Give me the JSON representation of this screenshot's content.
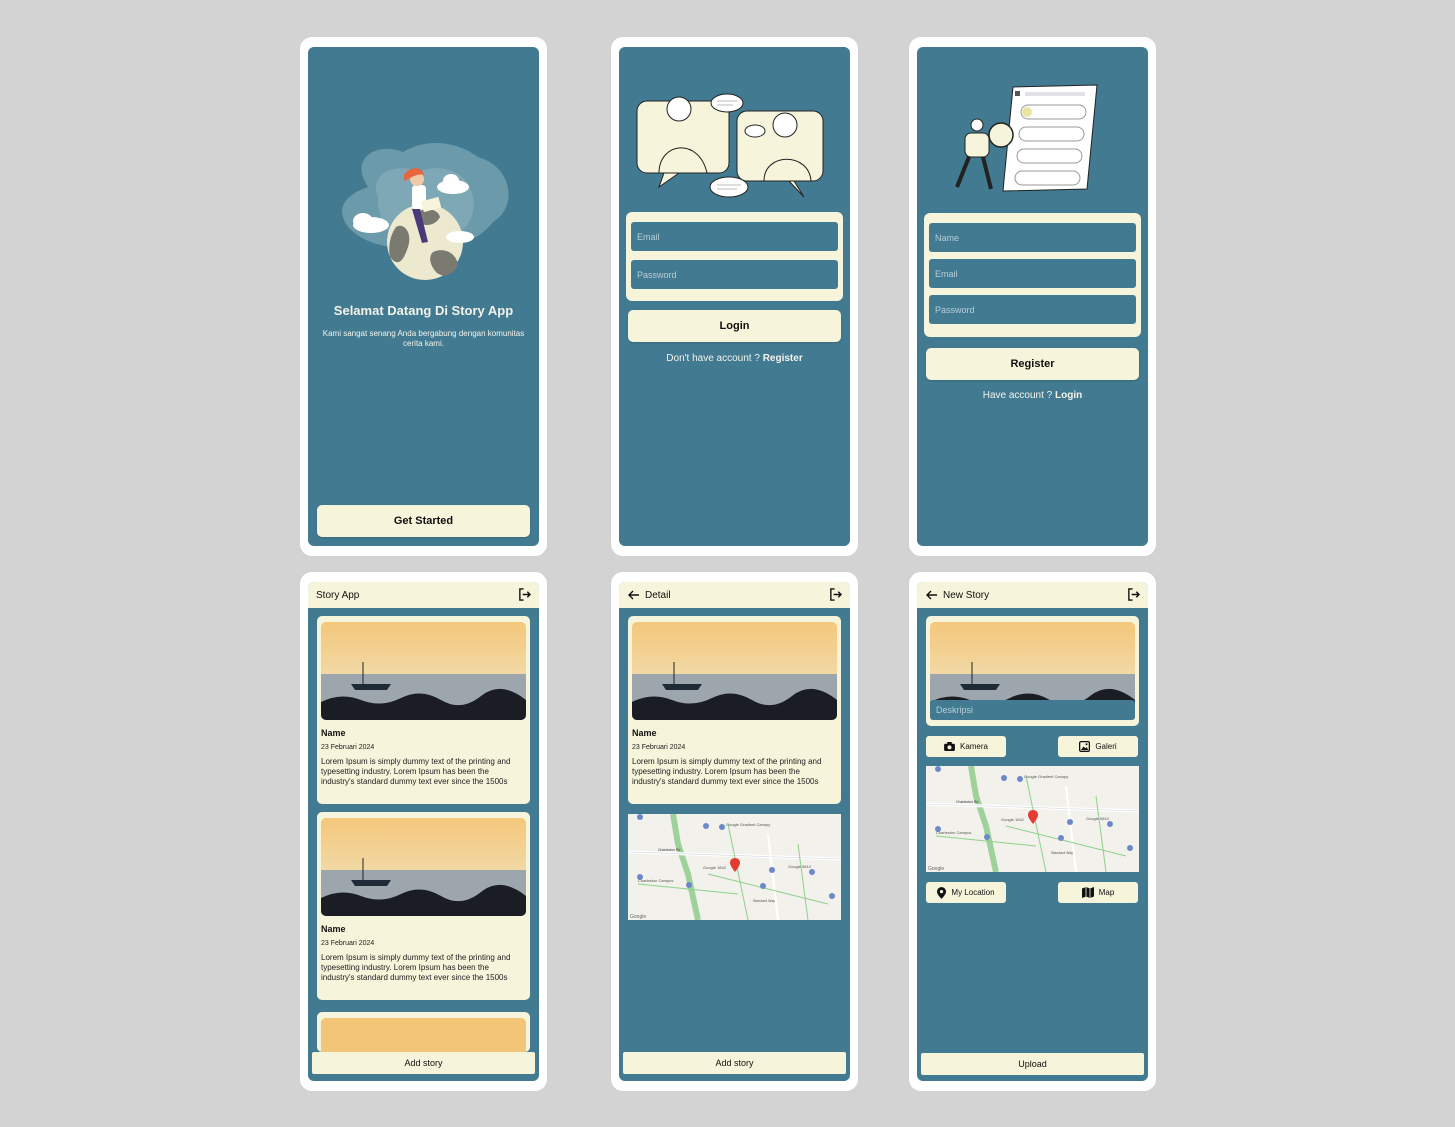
{
  "welcome": {
    "title": "Selamat Datang Di Story App",
    "subtitle": "Kami sangat senang Anda bergabung dengan komunitas cerita kami.",
    "get_started": "Get Started"
  },
  "login": {
    "email_placeholder": "Email",
    "password_placeholder": "Password",
    "login_button": "Login",
    "prompt": "Don't have account ? ",
    "register_link": "Register"
  },
  "register": {
    "name_placeholder": "Name",
    "email_placeholder": "Email",
    "password_placeholder": "Password",
    "register_button": "Register",
    "prompt": "Have account ? ",
    "login_link": "Login"
  },
  "list": {
    "app_title": "Story App",
    "stories": [
      {
        "name": "Name",
        "date": "23 Februari 2024",
        "description": "Lorem Ipsum is simply dummy text of the printing and typesetting industry. Lorem Ipsum has been the industry's standard dummy text ever since the 1500s"
      },
      {
        "name": "Name",
        "date": "23 Februari 2024",
        "description": "Lorem Ipsum is simply dummy text of the printing and typesetting industry. Lorem Ipsum has been the industry's standard dummy text ever since the 1500s"
      }
    ],
    "add_story": "Add story"
  },
  "detail": {
    "title": "Detail",
    "name": "Name",
    "date": "23 Februari 2024",
    "description": "Lorem Ipsum is simply dummy text of the printing and typesetting industry. Lorem Ipsum has been the industry's standard dummy text ever since the 1500s",
    "add_story": "Add story"
  },
  "new_story": {
    "title": "New Story",
    "description_placeholder": "Deskripsi",
    "camera_button": "Kamera",
    "gallery_button": "Galeri",
    "my_location_button": "My Location",
    "map_button": "Map",
    "upload": "Upload"
  },
  "map_labels": {
    "road1": "Charleston Rd",
    "road2": "Standard Way",
    "place1": "Google Gradient Canopy",
    "place2": "Charleston Campus",
    "place3": "Google 1842",
    "place4": "Google 5810",
    "brand": "Google"
  },
  "colors": {
    "background": "#d3d3d3",
    "screen": "#427a91",
    "cream": "#f6f4da"
  },
  "icons": {
    "logout": "logout-icon",
    "back": "arrow-left-icon",
    "camera": "camera-icon",
    "gallery": "image-icon",
    "location": "location-pin-icon",
    "map": "map-icon"
  }
}
